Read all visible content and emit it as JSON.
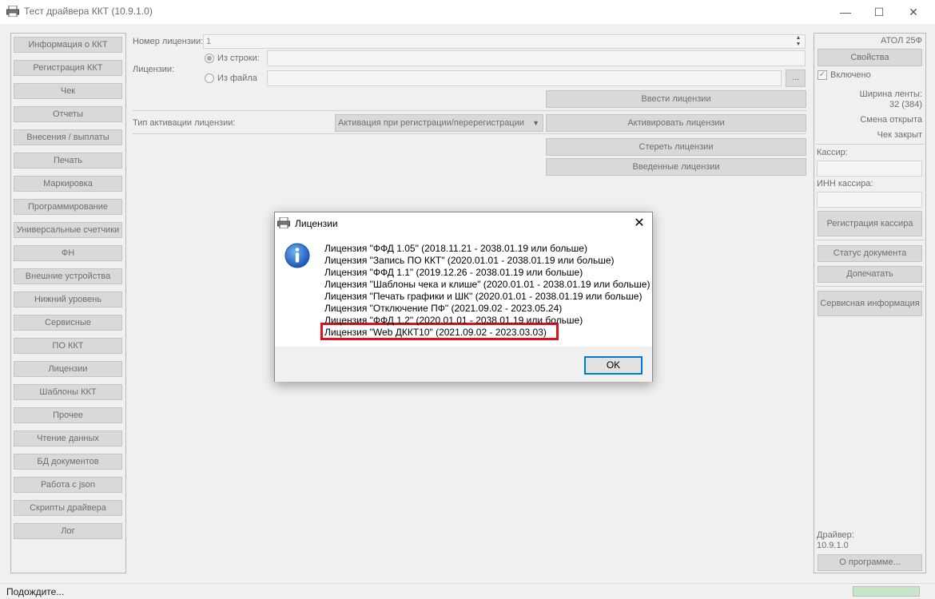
{
  "window": {
    "title": "Тест драйвера ККТ (10.9.1.0)",
    "minimize": "—",
    "maximize": "☐",
    "close": "✕"
  },
  "sidebar": {
    "items": [
      "Информация о ККТ",
      "Регистрация ККТ",
      "Чек",
      "Отчеты",
      "Внесения / выплаты",
      "Печать",
      "Маркировка",
      "Программирование",
      "Универсальные счетчики",
      "ФН",
      "Внешние устройства",
      "Нижний уровень",
      "Сервисные",
      "ПО ККТ",
      "Лицензии",
      "Шаблоны ККТ",
      "Прочее",
      "Чтение данных",
      "БД документов",
      "Работа с json",
      "Скрипты драйвера",
      "Лог"
    ]
  },
  "licenses_page": {
    "number_label": "Номер лицензии:",
    "number_value": "1",
    "licenses_label": "Лицензии:",
    "from_string_label": "Из строки:",
    "from_file_label": "Из файла",
    "browse_label": "...",
    "enter_button": "Ввести лицензии",
    "activation_type_label": "Тип активации лицензии:",
    "activation_type_value": "Активация при регистрации/перерегистрации",
    "activate_button": "Активировать лицензии",
    "erase_button": "Стереть лицензии",
    "entered_button": "Введенные лицензии"
  },
  "right_panel": {
    "device": "АТОЛ 25Ф",
    "properties_button": "Свойства",
    "enabled_label": "Включено",
    "tape_width_label": "Ширина ленты:",
    "tape_width_value": "32 (384)",
    "shift_status": "Смена открыта",
    "receipt_status": "Чек закрыт",
    "cashier_label": "Кассир:",
    "cashier_inn_label": "ИНН кассира:",
    "register_cashier_button": "Регистрация кассира",
    "doc_status_button": "Статус документа",
    "reprint_button": "Допечатать",
    "service_info_button": "Сервисная информация",
    "driver_label": "Драйвер:",
    "driver_version": "10.9.1.0",
    "about_button": "О программе..."
  },
  "statusbar": {
    "text": "Подождите...",
    "progress": 1.0
  },
  "dialog": {
    "title": "Лицензии",
    "close": "✕",
    "lines": [
      "Лицензия \"ФФД 1.05\" (2018.11.21 - 2038.01.19 или больше)",
      "Лицензия \"Запись ПО ККТ\" (2020.01.01 - 2038.01.19 или больше)",
      "Лицензия \"ФФД 1.1\" (2019.12.26 - 2038.01.19 или больше)",
      "Лицензия \"Шаблоны чека и клише\" (2020.01.01 - 2038.01.19 или больше)",
      "Лицензия \"Печать графики и ШК\" (2020.01.01 - 2038.01.19 или больше)",
      "Лицензия \"Отключение ПФ\" (2021.09.02 - 2023.05.24)",
      "Лицензия \"ФФД 1.2\" (2020.01.01 - 2038.01.19 или больше)",
      "Лицензия \"Web ДККТ10\" (2021.09.02 - 2023.03.03)"
    ],
    "highlighted_index": 5,
    "ok_button": "OK"
  },
  "colors": {
    "highlight_border": "#e01020",
    "focus_border": "#0078d7"
  }
}
